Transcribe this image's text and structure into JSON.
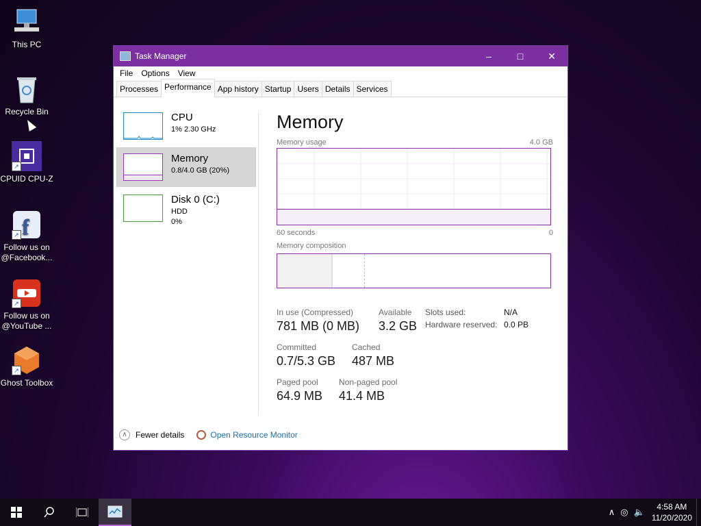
{
  "desktop": {
    "icons": [
      {
        "label": "This PC"
      },
      {
        "label": "Recycle Bin"
      },
      {
        "label": "CPUID CPU-Z"
      },
      {
        "label": "Follow us on @Facebook..."
      },
      {
        "label": "Follow us on @YouTube ..."
      },
      {
        "label": "Ghost Toolbox"
      }
    ]
  },
  "window": {
    "title": "Task Manager",
    "menu": [
      "File",
      "Options",
      "View"
    ],
    "tabs": [
      "Processes",
      "Performance",
      "App history",
      "Startup",
      "Users",
      "Details",
      "Services"
    ],
    "active_tab": "Performance"
  },
  "resources": [
    {
      "name": "CPU",
      "sub1": "1%  2.30 GHz",
      "sub2": ""
    },
    {
      "name": "Memory",
      "sub1": "0.8/4.0 GB (20%)",
      "sub2": ""
    },
    {
      "name": "Disk 0 (C:)",
      "sub1": "HDD",
      "sub2": "0%"
    }
  ],
  "memory": {
    "title": "Memory",
    "usage_label": "Memory usage",
    "max_label": "4.0 GB",
    "time_left": "60 seconds",
    "time_right": "0",
    "usage_fraction": 0.2,
    "composition_label": "Memory composition",
    "stats": {
      "in_use_label": "In use (Compressed)",
      "in_use_value": "781 MB (0 MB)",
      "available_label": "Available",
      "available_value": "3.2 GB",
      "committed_label": "Committed",
      "committed_value": "0.7/5.3 GB",
      "cached_label": "Cached",
      "cached_value": "487 MB",
      "paged_label": "Paged pool",
      "paged_value": "64.9 MB",
      "nonpaged_label": "Non-paged pool",
      "nonpaged_value": "41.4 MB",
      "slots_label": "Slots used:",
      "slots_value": "N/A",
      "hw_label": "Hardware reserved:",
      "hw_value": "0.0 PB"
    }
  },
  "footer": {
    "fewer_details": "Fewer details",
    "open_monitor": "Open Resource Monitor"
  },
  "taskbar": {
    "time": "4:58 AM",
    "date": "11/20/2020"
  },
  "colors": {
    "accent": "#7b2fa0",
    "memory_line": "#8b2fa6",
    "cpu_line": "#1b86c7"
  }
}
